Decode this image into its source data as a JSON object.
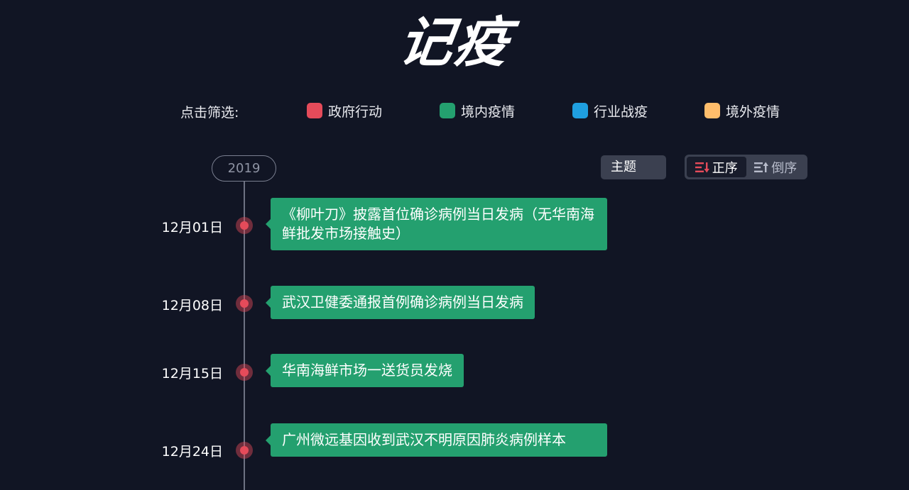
{
  "header": {
    "title": "记疫"
  },
  "filters": {
    "label": "点击筛选:",
    "items": [
      {
        "label": "政府行动",
        "color": "#e54b5a"
      },
      {
        "label": "境内疫情",
        "color": "#24a06f"
      },
      {
        "label": "行业战疫",
        "color": "#1f9fe0"
      },
      {
        "label": "境外疫情",
        "color": "#ffbd6b"
      }
    ]
  },
  "timeline": {
    "year": "2019",
    "theme_label": "主题",
    "sort": {
      "asc_label": "正序",
      "desc_label": "倒序",
      "active": "asc"
    },
    "events": [
      {
        "date": "12月01日",
        "text": "《柳叶刀》披露首位确诊病例当日发病（无华南海鲜批发市场接触史）",
        "category_color": "#24a06f",
        "dot_color": "#e54b5a"
      },
      {
        "date": "12月08日",
        "text": "武汉卫健委通报首例确诊病例当日发病",
        "category_color": "#24a06f",
        "dot_color": "#e54b5a"
      },
      {
        "date": "12月15日",
        "text": "华南海鲜市场一送货员发烧",
        "category_color": "#24a06f",
        "dot_color": "#e54b5a"
      },
      {
        "date": "12月24日",
        "text": "广州微远基因收到武汉不明原因肺炎病例样本",
        "category_color": "#24a06f",
        "dot_color": "#e54b5a"
      }
    ]
  }
}
